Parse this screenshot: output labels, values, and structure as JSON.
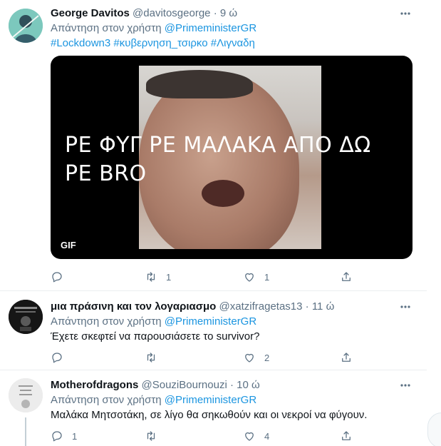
{
  "tweets": [
    {
      "name": "George Davitos",
      "handle": "@davitosgeorge",
      "time": "9 ώ",
      "reply_prefix": "Απάντηση στον χρήστη",
      "reply_mention": "@PrimeministerGR",
      "hashtags": [
        "#Lockdown3",
        "#κυβερνηση_τσιρκο",
        "#Λιγναδη"
      ],
      "media": {
        "caption_line1": "ΡΕ ΦΥΓ   ΡΕ ΜΑΛΑΚΑ ΑΠΟ ΔΩ",
        "caption_line2": "ΡΕ BRO",
        "badge": "GIF"
      },
      "actions": {
        "reply": "",
        "retweet": "1",
        "like": "1"
      }
    },
    {
      "name": "μια πράσινη και τον λογαριασμο",
      "handle": "@xatzifragetas13",
      "time": "11 ώ",
      "reply_prefix": "Απάντηση στον χρήστη",
      "reply_mention": "@PrimeministerGR",
      "text": "Έχετε σκεφτεί να παρουσιάσετε το survivor?",
      "actions": {
        "reply": "",
        "retweet": "",
        "like": "2"
      }
    },
    {
      "name": "Motherofdragons",
      "handle": "@SouziBournouzi",
      "time": "10 ώ",
      "reply_prefix": "Απάντηση στον χρήστη",
      "reply_mention": "@PrimeministerGR",
      "text": "Μαλάκα Μητσοτάκη, σε λίγο θα σηκωθούν και οι νεκροί να φύγουν.",
      "actions": {
        "reply": "1",
        "retweet": "",
        "like": "4"
      }
    }
  ],
  "separator": "·",
  "colors": {
    "accent": "#1b95e0",
    "secondary_text": "#5b7083",
    "divider": "#ebeef0"
  },
  "icons": [
    "reply-icon",
    "retweet-icon",
    "like-icon",
    "share-icon",
    "more-icon"
  ]
}
